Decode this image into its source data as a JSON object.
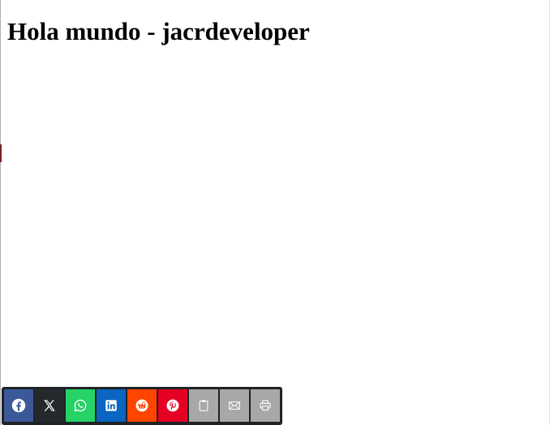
{
  "page": {
    "title": "Hola mundo - jacrdeveloper"
  },
  "share_bar": {
    "buttons": [
      {
        "id": "facebook",
        "icon": "facebook-icon",
        "color": "#3b5998"
      },
      {
        "id": "x",
        "icon": "x-icon",
        "color": "#25292d"
      },
      {
        "id": "whatsapp",
        "icon": "whatsapp-icon",
        "color": "#25d366"
      },
      {
        "id": "linkedin",
        "icon": "linkedin-icon",
        "color": "#0a66c2"
      },
      {
        "id": "reddit",
        "icon": "reddit-icon",
        "color": "#ff4500"
      },
      {
        "id": "pinterest",
        "icon": "pinterest-icon",
        "color": "#e60023"
      },
      {
        "id": "copy",
        "icon": "clipboard-icon",
        "color": "#a8a8a8"
      },
      {
        "id": "email",
        "icon": "envelope-icon",
        "color": "#a8a8a8"
      },
      {
        "id": "print",
        "icon": "printer-icon",
        "color": "#a8a8a8"
      }
    ]
  }
}
